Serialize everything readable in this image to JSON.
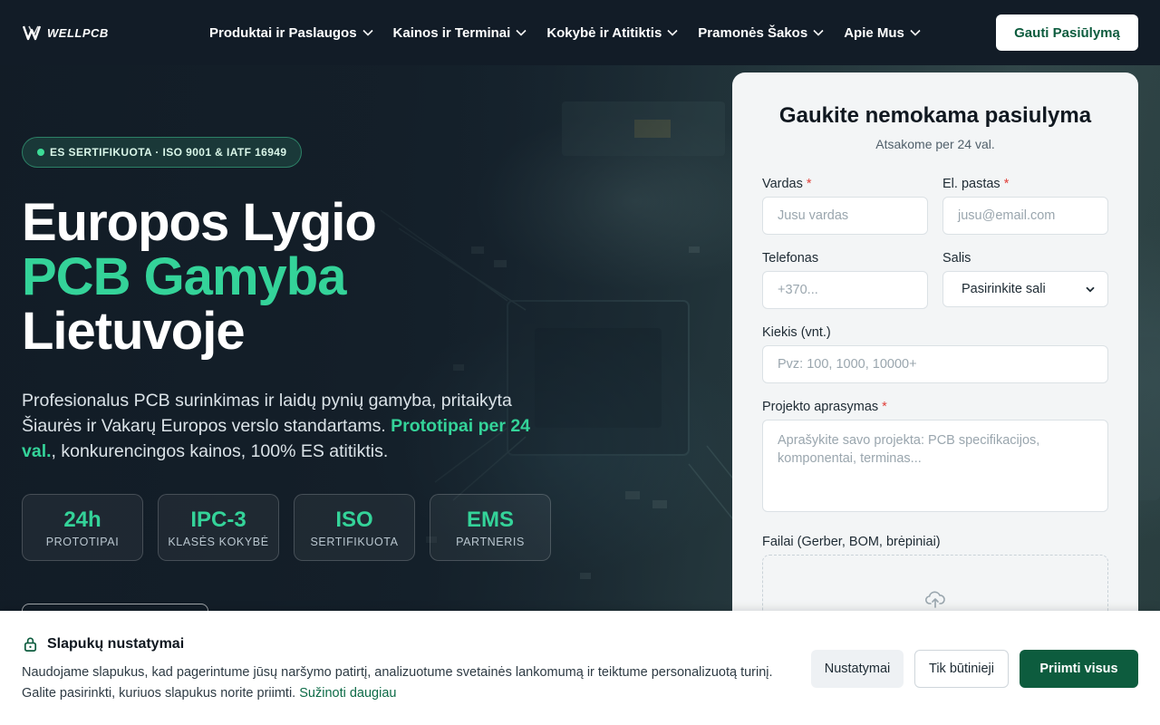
{
  "header": {
    "logo_text": "WELLPCB",
    "nav": [
      {
        "label": "Produktai ir Paslaugos"
      },
      {
        "label": "Kainos ir Terminai"
      },
      {
        "label": "Kokybė ir Atitiktis"
      },
      {
        "label": "Pramonės Šakos"
      },
      {
        "label": "Apie Mus"
      }
    ],
    "cta_label": "Gauti Pasiūlymą"
  },
  "hero": {
    "badge": "ES SERTIFIKUOTA · ISO 9001 & IATF 16949",
    "title_line1": "Europos Lygio",
    "title_line2": "PCB Gamyba",
    "title_line3": "Lietuvoje",
    "desc_part1": "Profesionalus PCB surinkimas ir laidų pynių gamyba, pritaikyta Šiaurės ir Vakarų Europos verslo standartams. ",
    "desc_highlight": "Prototipai per 24 val.",
    "desc_part2": ", konkurencingos kainos, 100% ES atitiktis.",
    "stats": [
      {
        "value": "24h",
        "label": "PROTOTIPAI"
      },
      {
        "value": "IPC-3",
        "label": "KLASĖS KOKYBĖ"
      },
      {
        "value": "ISO",
        "label": "SERTIFIKUOTA"
      },
      {
        "value": "EMS",
        "label": "PARTNERIS"
      }
    ]
  },
  "form": {
    "title": "Gaukite nemokama pasiulyma",
    "subtitle": "Atsakome per 24 val.",
    "name_label": "Vardas",
    "name_placeholder": "Jusu vardas",
    "email_label": "El. pastas",
    "email_placeholder": "jusu@email.com",
    "phone_label": "Telefonas",
    "phone_placeholder": "+370...",
    "country_label": "Salis",
    "country_value": "Pasirinkite sali",
    "qty_label": "Kiekis (vnt.)",
    "qty_placeholder": "Pvz: 100, 1000, 10000+",
    "desc_label": "Projekto aprasymas",
    "desc_placeholder": "Aprašykite savo projekta: PCB specifikacijos, komponentai, terminas...",
    "files_label": "Failai (Gerber, BOM, brėpiniai)",
    "required_mark": "*"
  },
  "cookie": {
    "title": "Slapukų nustatymai",
    "text": "Naudojame slapukus, kad pagerintume jūsų naršymo patirtį, analizuotume svetainės lankomumą ir teiktume personalizuotą turinį. Galite pasirinkti, kuriuos slapukus norite priimti. ",
    "link": "Sužinoti daugiau",
    "btn_settings": "Nustatymai",
    "btn_necessary": "Tik būtinieji",
    "btn_accept": "Priimti visus"
  },
  "colors": {
    "accent_green": "#34d399",
    "brand_dark_green": "#0d5c3e",
    "header_bg": "#121c27",
    "required_red": "#e0403a"
  },
  "icons": [
    "wellpcb-logo",
    "chevron-down-icon",
    "upload-cloud-icon",
    "lock-icon"
  ]
}
